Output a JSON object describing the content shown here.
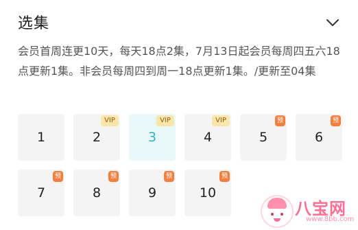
{
  "header": {
    "title": "选集",
    "collapse_icon": "chevron-down-icon"
  },
  "description": "会员首周连更10天，每天18点2集，7月13日起会员每周四五六18点更新1集。非会员每周四到周一18点更新1集。/更新至04集",
  "episodes": [
    {
      "number": "1",
      "tag": "",
      "active": false
    },
    {
      "number": "2",
      "tag": "VIP",
      "active": false
    },
    {
      "number": "3",
      "tag": "VIP",
      "active": true
    },
    {
      "number": "4",
      "tag": "VIP",
      "active": false
    },
    {
      "number": "5",
      "tag": "预",
      "active": false
    },
    {
      "number": "6",
      "tag": "预",
      "active": false
    },
    {
      "number": "7",
      "tag": "预",
      "active": false
    },
    {
      "number": "8",
      "tag": "预",
      "active": false
    },
    {
      "number": "9",
      "tag": "预",
      "active": false
    },
    {
      "number": "10",
      "tag": "预",
      "active": false
    }
  ],
  "watermark": {
    "name": "八宝网",
    "url": "www.8bb.com"
  },
  "colors": {
    "active_text": "#2fb3bf",
    "active_bg": "#e8f8fa",
    "tile_bg": "#f4f4f4",
    "vip_bg": "#f9e6a8",
    "vip_text": "#8a5c17",
    "preview_bg": "#f27f3d"
  }
}
